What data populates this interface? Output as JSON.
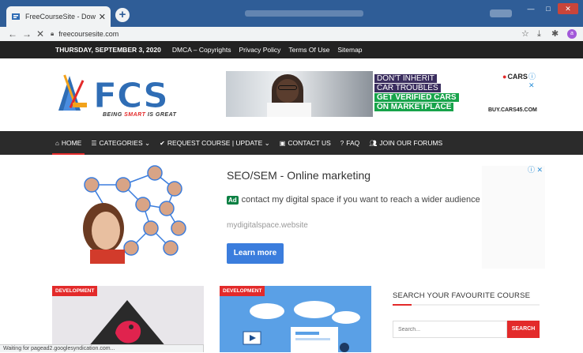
{
  "browser": {
    "tab_title": "FreeCourseSite - Download Udemy Courses",
    "tab_close": "✕",
    "new_tab": "+",
    "address": "freecoursesite.com",
    "profile_initial": "a"
  },
  "topbar": {
    "date": "THURSDAY, SEPTEMBER 3, 2020",
    "links": [
      "DMCA – Copyrights",
      "Privacy Policy",
      "Terms Of Use",
      "Sitemap"
    ]
  },
  "logo": {
    "text": "FCS",
    "tagline_prefix": "BEING ",
    "tagline_highlight": "SMART",
    "tagline_suffix": " IS GREAT"
  },
  "banner_ad": {
    "line1": "DON'T INHERIT",
    "line2": "CAR TROUBLES",
    "line3": "GET VERIFIED CARS",
    "line4": "ON MARKETPLACE",
    "brand": "CARS",
    "url": "BUY.CARS45.COM"
  },
  "nav": {
    "items": [
      {
        "label": "HOME",
        "icon": "home-icon"
      },
      {
        "label": "CATEGORIES ⌄",
        "icon": "menu-icon"
      },
      {
        "label": "REQUEST COURSE | UPDATE ⌄",
        "icon": "check-circle-icon"
      },
      {
        "label": "CONTACT US",
        "icon": "contact-card-icon"
      },
      {
        "label": "FAQ",
        "icon": "help-icon"
      },
      {
        "label": "JOIN OUR FORUMS",
        "icon": "users-icon"
      }
    ]
  },
  "text_ad": {
    "title": "SEO/SEM - Online marketing",
    "badge": "Ad",
    "line": "contact my digital space if you want to reach a wider audience",
    "url": "mydigitalspace.website",
    "cta": "Learn more"
  },
  "cards": [
    {
      "category": "DEVELOPMENT"
    },
    {
      "category": "DEVELOPMENT"
    }
  ],
  "sidebar": {
    "search_title": "SEARCH YOUR FAVOURITE COURSE",
    "search_placeholder": "Search...",
    "search_button": "SEARCH"
  },
  "status": "Waiting for pagead2.googlesyndication.com...",
  "colors": {
    "accent": "#e32a2a",
    "chrome_frame": "#2f5d97",
    "logo_blue": "#2f6db5",
    "nav_bg": "#2b2b2b"
  }
}
